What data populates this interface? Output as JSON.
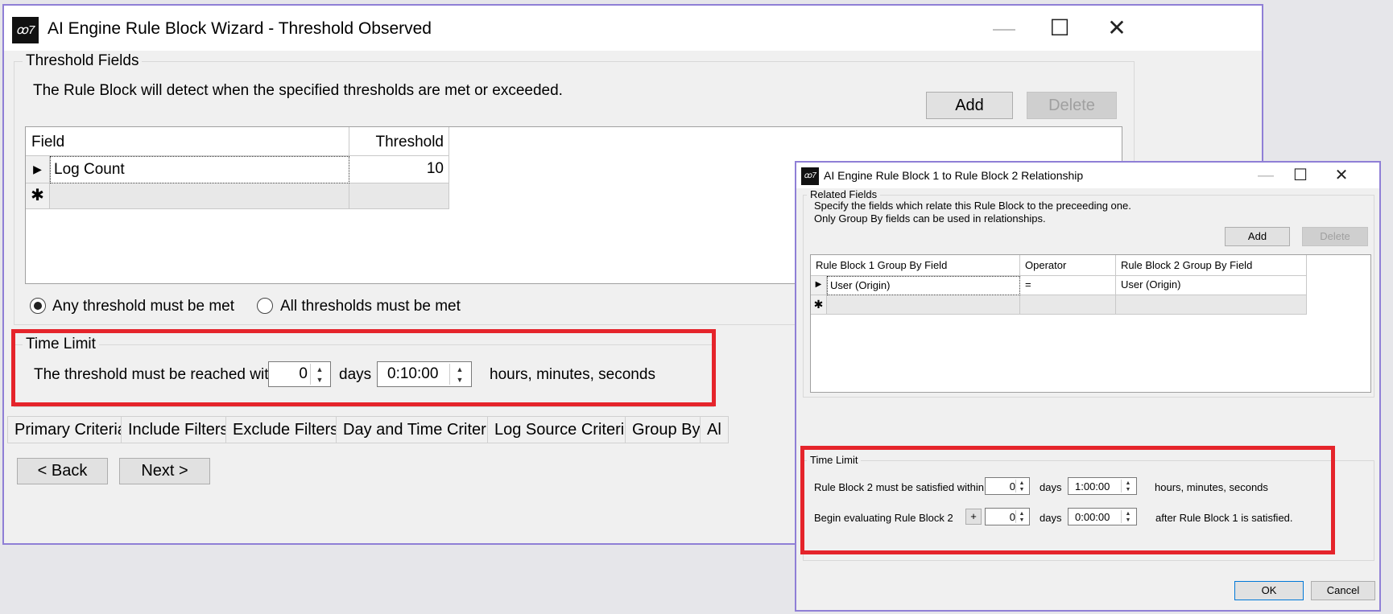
{
  "main": {
    "title": "AI Engine Rule Block Wizard - Threshold Observed",
    "threshold_fields": {
      "legend": "Threshold Fields",
      "description": "The Rule Block will detect when the specified thresholds are met or exceeded.",
      "add_label": "Add",
      "delete_label": "Delete",
      "columns": [
        "Field",
        "Threshold"
      ],
      "rows": [
        {
          "field": "Log Count",
          "threshold": "10"
        }
      ],
      "any_label": "Any threshold must be met",
      "all_label": "All thresholds must be met",
      "selected": "any"
    },
    "time_limit": {
      "legend": "Time Limit",
      "text": "The threshold must be reached within",
      "days_value": "0",
      "days_label": "days",
      "time_value": "0:10:00",
      "units_label": "hours, minutes, seconds"
    },
    "tabs": [
      "Primary Criteria",
      "Include Filters",
      "Exclude Filters",
      "Day and Time Criteria",
      "Log Source Criteria",
      "Group By",
      "Al"
    ],
    "back_label": "< Back",
    "next_label": "Next >"
  },
  "dialog": {
    "title": "AI Engine Rule Block 1 to Rule Block 2 Relationship",
    "related_fields": {
      "legend": "Related Fields",
      "desc1": "Specify the fields which relate this Rule Block to the preceeding one.",
      "desc2": "Only Group By fields can be used in relationships.",
      "add_label": "Add",
      "delete_label": "Delete",
      "columns": [
        "Rule Block 1 Group By Field",
        "Operator",
        "Rule Block 2 Group By Field"
      ],
      "rows": [
        {
          "rb1": "User (Origin)",
          "op": "=",
          "rb2": "User (Origin)"
        }
      ]
    },
    "time_limit": {
      "legend": "Time Limit",
      "row1_text": "Rule Block 2 must be satisfied within",
      "row1_days": "0",
      "row1_time": "1:00:00",
      "row1_units": "hours, minutes, seconds",
      "row2_text": "Begin evaluating Rule Block 2",
      "row2_sign": "+",
      "row2_days": "0",
      "row2_time": "0:00:00",
      "row2_units": "after Rule Block 1 is satisfied.",
      "days_label": "days"
    },
    "ok_label": "OK",
    "cancel_label": "Cancel"
  },
  "icons": {
    "app": "ai-engine-logo-icon",
    "minimize": "minimize-icon",
    "maximize": "maximize-icon",
    "close": "close-icon"
  },
  "colors": {
    "highlight_box": "#e5242b",
    "window_border": "#8f7fd6"
  }
}
